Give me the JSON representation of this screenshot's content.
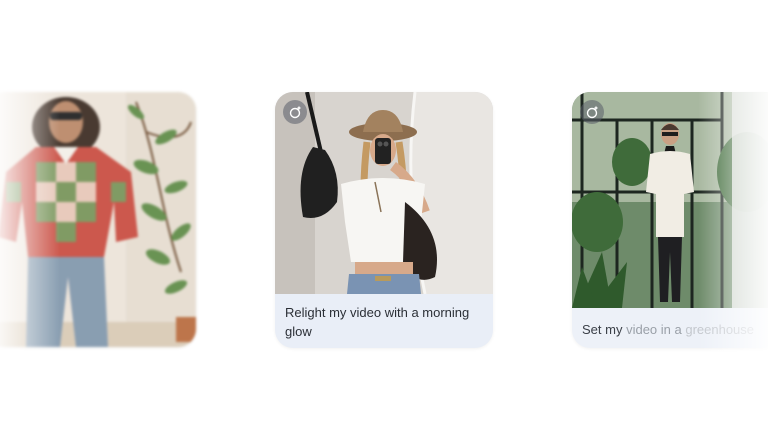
{
  "cards": [
    {
      "id": "left",
      "image": "illustrated-woman-plaid-sweater"
    },
    {
      "id": "center",
      "image": "woman-cowboy-hat-mirror-selfie",
      "icon": "sparkle-edit-icon",
      "prompt": "Relight my video with a morning glow"
    },
    {
      "id": "right",
      "image": "woman-in-greenhouse",
      "icon": "sparkle-edit-icon",
      "prompt_parts": [
        "Set my ",
        "video",
        " in a ",
        "greenhouse"
      ]
    }
  ],
  "colors": {
    "caption_bg": "#e9eef7",
    "caption_text": "#2b2f36",
    "page_bg": "#ffffff"
  }
}
